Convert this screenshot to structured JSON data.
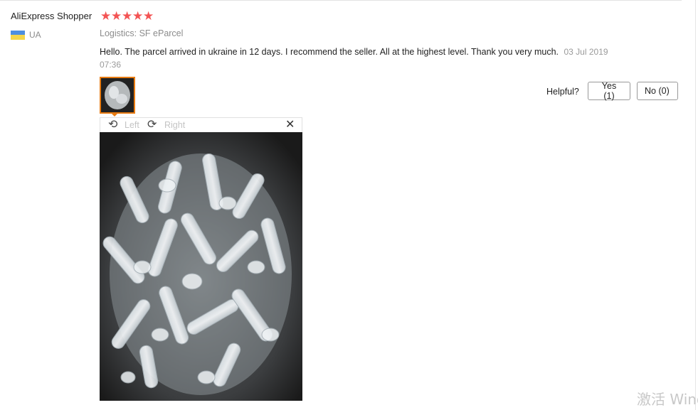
{
  "review": {
    "user_name": "AliExpress Shopper",
    "country_code": "UA",
    "rating": 5,
    "star_glyph": "★",
    "logistics": "Logistics: SF eParcel",
    "text": "Hello. The parcel arrived in ukraine in 12 days. I recommend the seller. All at the highest level. Thank you very much.",
    "date": "03 Jul 2019 07:36",
    "photo_alt": "Review photo",
    "colors": {
      "star": "#f35454",
      "thumb_border": "#e87b12",
      "flag_blue": "#4d8fe0",
      "flag_yellow": "#f4d64a"
    }
  },
  "helpful": {
    "label": "Helpful?",
    "yes_label": "Yes (1)",
    "no_label": "No (0)"
  },
  "image_viewer": {
    "rotate_left_label": "Left",
    "rotate_right_label": "Right",
    "rotate_left_icon": "rotate-left-icon",
    "rotate_right_icon": "rotate-right-icon",
    "close_icon": "close-icon",
    "rotate_left_glyph": "⟲",
    "rotate_right_glyph": "⟳",
    "close_glyph": "✕"
  },
  "watermark": {
    "text": "激活 Wind"
  }
}
